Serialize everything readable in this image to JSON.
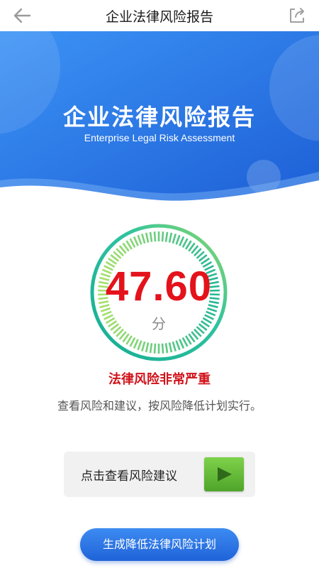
{
  "header": {
    "title": "企业法律风险报告"
  },
  "banner": {
    "title": "企业法律风险报告",
    "subtitle": "Enterprise Legal Risk Assessment"
  },
  "score": {
    "value": "47.60",
    "unit": "分",
    "level_fraction": 0.476
  },
  "risk": {
    "level": "法律风险非常严重",
    "description": "查看风险和建议，按风险降低计划实行。"
  },
  "advice_card": {
    "label": "点击查看风险建议"
  },
  "plan_button": {
    "label": "生成降低法律风险计划"
  },
  "colors": {
    "accent": "#2f7cf0",
    "danger": "#e4121b",
    "gauge_dark": "#18b39a",
    "gauge_light": "#a6e06a",
    "play": "#5cb832"
  }
}
